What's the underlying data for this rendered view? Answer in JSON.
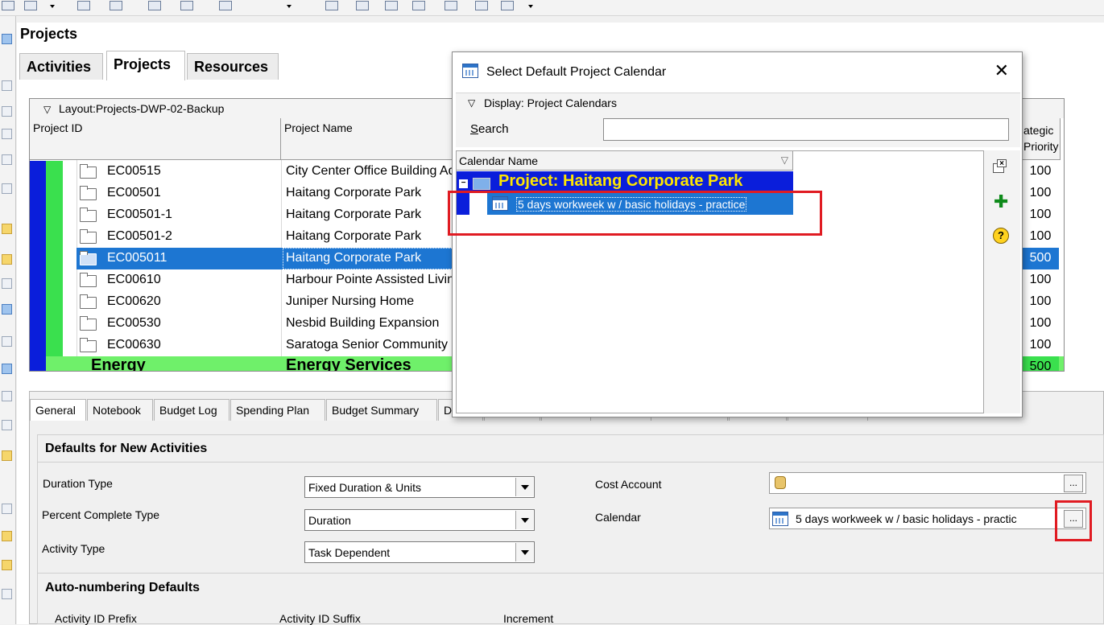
{
  "page": {
    "title": "Projects"
  },
  "main_tabs": [
    {
      "label": "Activities"
    },
    {
      "label": "Projects"
    },
    {
      "label": "Resources"
    }
  ],
  "grid": {
    "layout_label": "Layout:Projects-DWP-02-Backup",
    "columns": {
      "id": "Project ID",
      "name": "Project Name",
      "priority": "ategic\nPriority"
    },
    "rows": [
      {
        "id": "EC00515",
        "name": "City Center Office Building Ad",
        "priority": "100"
      },
      {
        "id": "EC00501",
        "name": "Haitang Corporate Park",
        "priority": "100"
      },
      {
        "id": "EC00501-1",
        "name": "Haitang Corporate Park",
        "priority": "100"
      },
      {
        "id": "EC00501-2",
        "name": "Haitang Corporate Park",
        "priority": "100"
      },
      {
        "id": "EC005011",
        "name": "Haitang Corporate Park",
        "priority": "500"
      },
      {
        "id": "EC00610",
        "name": "Harbour Pointe Assisted Livin",
        "priority": "100"
      },
      {
        "id": "EC00620",
        "name": "Juniper Nursing Home",
        "priority": "100"
      },
      {
        "id": "EC00530",
        "name": "Nesbid Building Expansion",
        "priority": "100"
      },
      {
        "id": "EC00630",
        "name": "Saratoga Senior Community",
        "priority": "100"
      },
      {
        "id": "Energy",
        "name": "Energy Services",
        "priority": "500"
      }
    ]
  },
  "bottom_tabs": [
    {
      "label": "General"
    },
    {
      "label": "Notebook"
    },
    {
      "label": "Budget Log"
    },
    {
      "label": "Spending Plan"
    },
    {
      "label": "Budget Summary"
    },
    {
      "label": "Da"
    }
  ],
  "defaults": {
    "section_title": "Defaults for New Activities",
    "duration_type_label": "Duration Type",
    "duration_type_value": "Fixed Duration & Units",
    "percent_complete_label": "Percent Complete Type",
    "percent_complete_value": "Duration",
    "activity_type_label": "Activity Type",
    "activity_type_value": "Task Dependent",
    "cost_account_label": "Cost Account",
    "calendar_label": "Calendar",
    "calendar_value": "5 days workweek w / basic holidays - practic",
    "ellipsis": "..."
  },
  "autonum": {
    "section_title": "Auto-numbering Defaults",
    "prefix_label": "Activity ID Prefix",
    "suffix_label": "Activity ID Suffix",
    "increment_label": "Increment"
  },
  "dialog": {
    "title": "Select Default Project Calendar",
    "display_label": "Display: Project Calendars",
    "search_label_u": "S",
    "search_label_rest": "earch",
    "search_value": "",
    "column_header": "Calendar Name",
    "project_row": "Project: Haitang Corporate Park",
    "calendar_row": "5 days workweek w / basic holidays - practice",
    "close_glyph": "✕"
  },
  "colors": {
    "project_blue": "#0a1edb",
    "wbs_green": "#3ae04e",
    "selection_blue": "#1d76d2",
    "highlight_red": "#e01b22",
    "project_text_yellow": "#ffe600"
  }
}
